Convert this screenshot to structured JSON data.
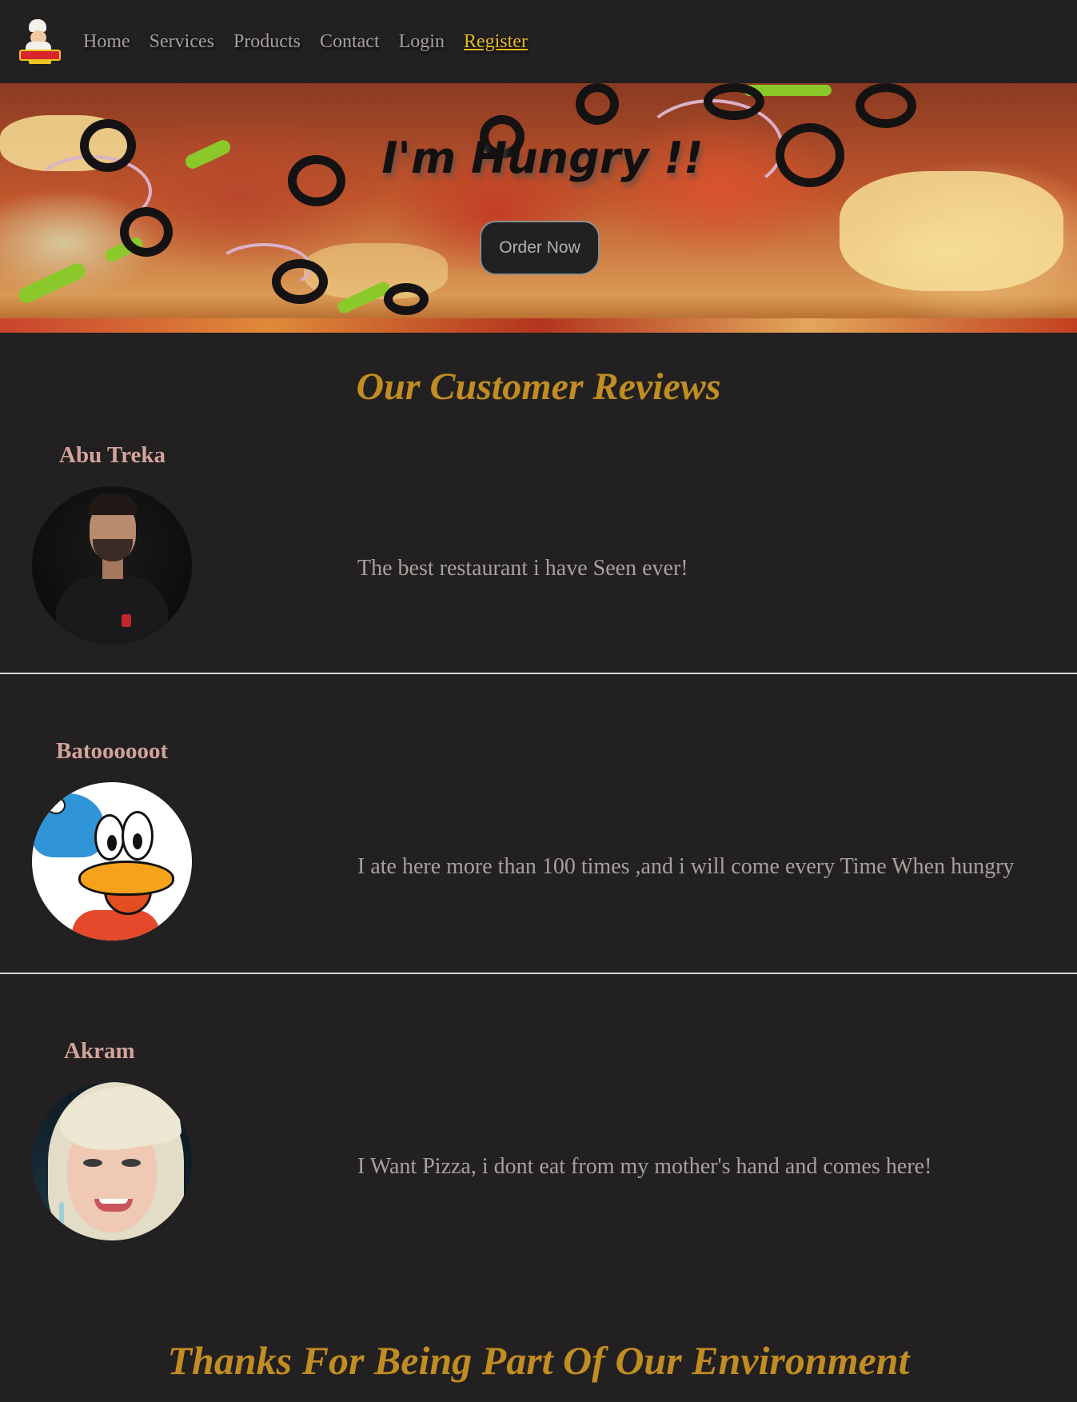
{
  "nav": {
    "logo_icon": "chef-logo-icon",
    "items": [
      {
        "label": "Home",
        "active": false
      },
      {
        "label": "Services",
        "active": false
      },
      {
        "label": "Products",
        "active": false
      },
      {
        "label": "Contact",
        "active": false
      },
      {
        "label": "Login",
        "active": false
      },
      {
        "label": "Register",
        "active": true
      }
    ]
  },
  "hero": {
    "title": "I'm Hungry !!",
    "button_label": "Order Now"
  },
  "reviews": {
    "title": "Our Customer Reviews",
    "items": [
      {
        "name": "Abu Treka",
        "text": "The best restaurant i have Seen ever!"
      },
      {
        "name": "Batoooooot",
        "text": "I ate here more than 100 times ,and i will come every Time When hungry"
      },
      {
        "name": "Akram",
        "text": "I Want Pizza, i dont eat from my mother's hand and comes here!"
      }
    ]
  },
  "footer": {
    "title": "Thanks For Being Part Of Our Environment"
  },
  "colors": {
    "background": "#222020",
    "accent_gold": "#c18d22",
    "active_link": "#e8b826",
    "name_pink": "#d3a39b"
  }
}
